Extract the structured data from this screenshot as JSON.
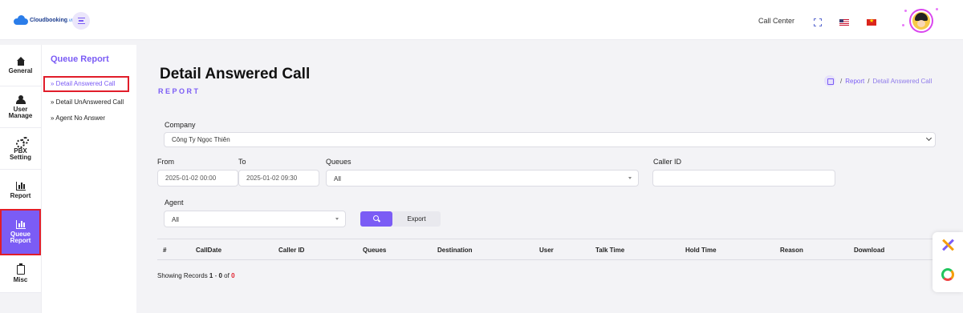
{
  "header": {
    "logo_name": "Cloudbooking",
    "logo_suffix": ".vn",
    "call_center": "Call Center"
  },
  "sidebar": {
    "items": [
      {
        "label": "General",
        "icon": "home-icon"
      },
      {
        "label": "User Manage",
        "icon": "users-icon"
      },
      {
        "label": "PBX Setting",
        "icon": "gears-icon"
      },
      {
        "label": "Report",
        "icon": "chart-icon"
      },
      {
        "label": "Queue Report",
        "icon": "chart-icon",
        "active": true
      },
      {
        "label": "Misc",
        "icon": "clipboard-icon"
      }
    ]
  },
  "submenu": {
    "title": "Queue Report",
    "items": [
      {
        "label": "» Detail Answered Call",
        "active": true
      },
      {
        "label": "» Detail UnAnswered Call"
      },
      {
        "label": "» Agent No Answer"
      }
    ]
  },
  "page": {
    "title": "Detail Answered Call",
    "subtitle": "REPORT"
  },
  "breadcrumb": {
    "sep": "/",
    "link": "Report",
    "current": "Detail Answered Call"
  },
  "form": {
    "company_label": "Company",
    "company_value": "Công Ty Ngọc Thiên",
    "from_label": "From",
    "from_value": "2025-01-02 00:00",
    "to_label": "To",
    "to_value": "2025-01-02 09:30",
    "queues_label": "Queues",
    "queues_value": "All",
    "caller_id_label": "Caller ID",
    "caller_id_value": "",
    "agent_label": "Agent",
    "agent_value": "All",
    "export_label": "Export"
  },
  "table": {
    "columns": [
      "#",
      "CallDate",
      "Caller ID",
      "Queues",
      "Destination",
      "User",
      "Talk Time",
      "Hold Time",
      "Reason",
      "Download"
    ],
    "rows": []
  },
  "records": {
    "prefix": "Showing Records ",
    "start": "1",
    "dash": " - ",
    "end": "0",
    "of": " of ",
    "total": "0"
  },
  "colors": {
    "accent": "#7b5cf5",
    "highlight_border": "#e11d2a",
    "background": "#f3f3f6"
  }
}
